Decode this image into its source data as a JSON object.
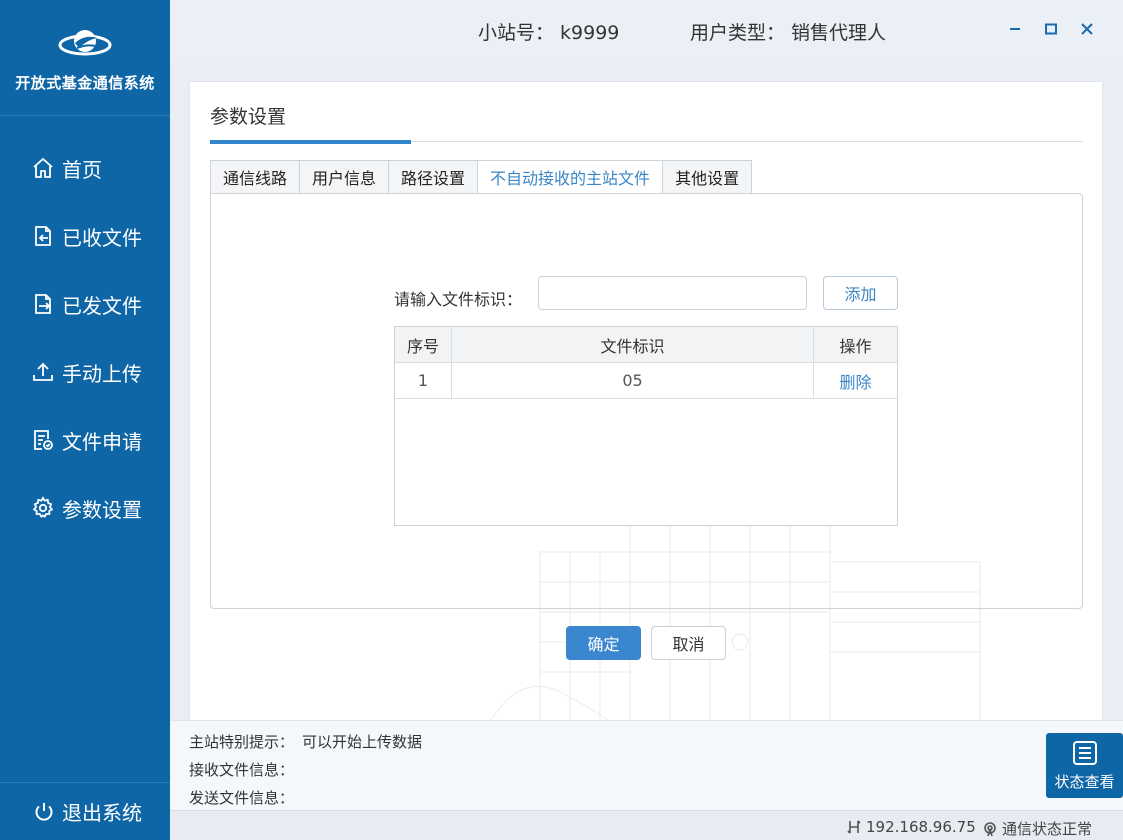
{
  "app": {
    "name": "开放式基金通信系统"
  },
  "header": {
    "station_label": "小站号：",
    "station_value": "k9999",
    "usertype_label": "用户类型：",
    "usertype_value": "销售代理人"
  },
  "sidebar": {
    "items": [
      {
        "label": "首页",
        "icon": "home-icon"
      },
      {
        "label": "已收文件",
        "icon": "received-file-icon"
      },
      {
        "label": "已发文件",
        "icon": "sent-file-icon"
      },
      {
        "label": "手动上传",
        "icon": "upload-icon"
      },
      {
        "label": "文件申请",
        "icon": "file-request-icon"
      },
      {
        "label": "参数设置",
        "icon": "gear-icon"
      }
    ],
    "logout_label": "退出系统"
  },
  "page": {
    "title": "参数设置",
    "tabs": [
      {
        "label": "通信线路",
        "active": false
      },
      {
        "label": "用户信息",
        "active": false
      },
      {
        "label": "路径设置",
        "active": false
      },
      {
        "label": "不自动接收的主站文件",
        "active": true
      },
      {
        "label": "其他设置",
        "active": false
      }
    ],
    "form": {
      "label": "请输入文件标识：",
      "input_value": "",
      "add_label": "添加"
    },
    "table": {
      "headers": [
        "序号",
        "文件标识",
        "操作"
      ],
      "rows": [
        {
          "index": "1",
          "file_id": "05",
          "action": "删除"
        }
      ]
    },
    "ok_label": "确定",
    "cancel_label": "取消"
  },
  "info": {
    "notice_label": "主站特别提示：",
    "notice_value": "可以开始上传数据",
    "recv_label": "接收文件信息：",
    "send_label": "发送文件信息：",
    "status_view_label": "状态查看"
  },
  "statusbar": {
    "ip": "192.168.96.75",
    "comm_status": "通信状态正常"
  },
  "colors": {
    "sidebar": "#0f66a7",
    "accent": "#3a86cf"
  }
}
